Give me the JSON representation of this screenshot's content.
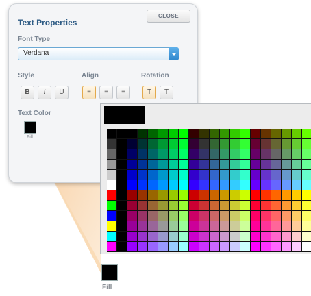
{
  "panel": {
    "title": "Text Properties",
    "close_label": "CLOSE",
    "font_type_label": "Font Type",
    "font_value": "Verdana",
    "style_label": "Style",
    "align_label": "Align",
    "rotation_label": "Rotation",
    "style_buttons": [
      "B",
      "I",
      "U"
    ],
    "align_buttons": [
      "≡",
      "≡",
      "≡"
    ],
    "rotation_buttons": [
      "T",
      "T"
    ],
    "text_color_label": "Text Color",
    "fill_label": "Fill"
  },
  "picker": {
    "fill_label": "Fill",
    "selected_color": "#000000"
  },
  "colors": {
    "accent": "#2f5c85",
    "dropdown_border": "#6aa8d4",
    "active_outline": "#e3a94b"
  }
}
